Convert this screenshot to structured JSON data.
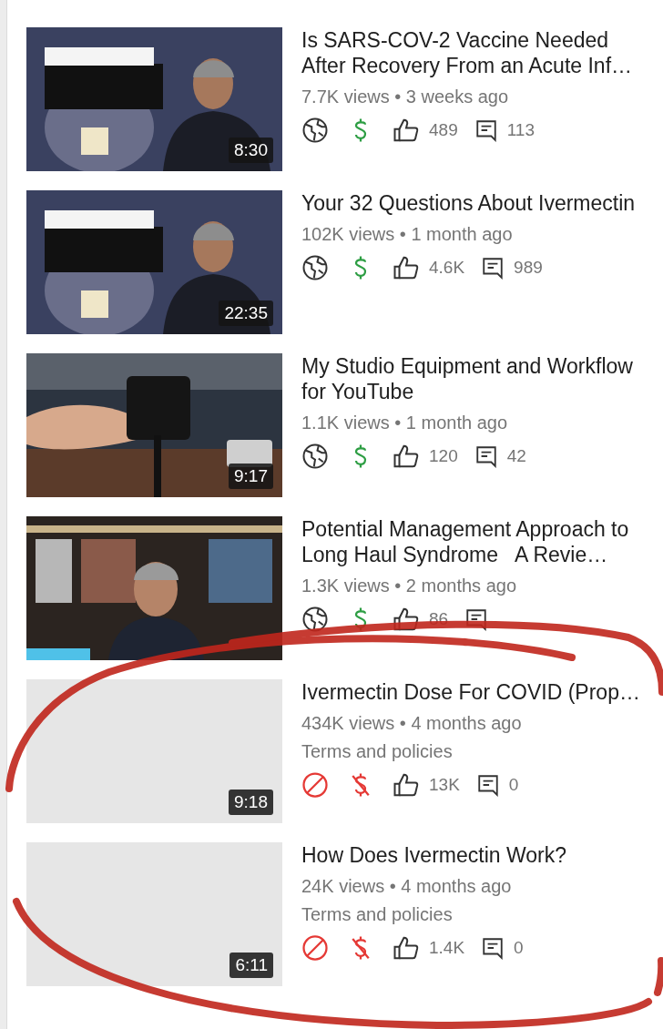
{
  "videos": [
    {
      "title": "Is SARS-COV-2 Vaccine Needed After Recovery From an Acute Inf…",
      "has_thumbnail": true,
      "duration": "8:30",
      "stats": "7.7K views • 3 weeks ago",
      "public": true,
      "monetized": true,
      "likes": "489",
      "comments": "113"
    },
    {
      "title": "Your 32 Questions About Ivermectin",
      "has_thumbnail": true,
      "duration": "22:35",
      "stats": "102K views • 1 month ago",
      "public": true,
      "monetized": true,
      "likes": "4.6K",
      "comments": "989"
    },
    {
      "title": "My Studio Equipment and Workflow for YouTube",
      "has_thumbnail": true,
      "duration": "9:17",
      "stats": "1.1K views • 1 month ago",
      "public": true,
      "monetized": true,
      "likes": "120",
      "comments": "42"
    },
    {
      "title": "Potential Management Approach to Long Haul Syndrome   A Revie…",
      "has_thumbnail": true,
      "stats": "1.3K views • 2 months ago",
      "public": true,
      "monetized": true,
      "likes": "86"
    },
    {
      "title": "Ivermectin Dose For COVID (Prop…",
      "has_thumbnail": false,
      "duration": "9:18",
      "stats": "434K views • 4 months ago",
      "notice": "Terms and policies",
      "public": false,
      "monetized": false,
      "likes": "13K",
      "comments": "0"
    },
    {
      "title": "How Does Ivermectin Work?",
      "has_thumbnail": false,
      "duration": "6:11",
      "stats": "24K views • 4 months ago",
      "notice": "Terms and policies",
      "public": false,
      "monetized": false,
      "likes": "1.4K",
      "comments": "0"
    }
  ]
}
